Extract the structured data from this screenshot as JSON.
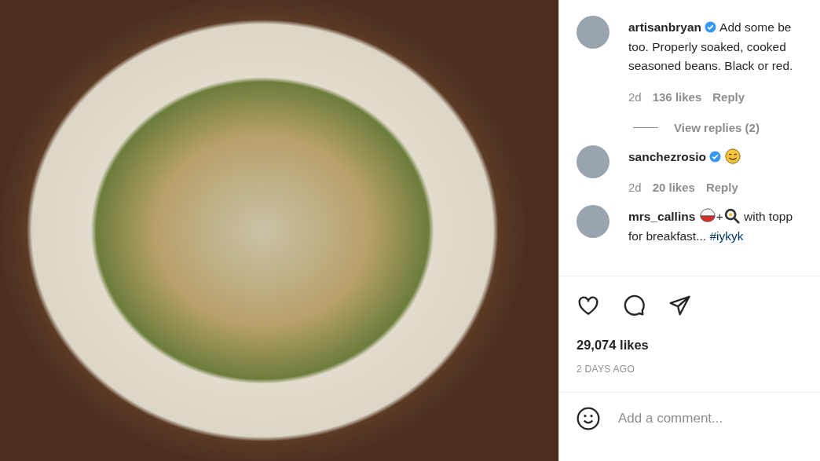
{
  "comments": [
    {
      "username": "artisanbryan",
      "verified": true,
      "segments": [
        {
          "kind": "text",
          "text": "Add some be\ntoo. Properly soaked, cooked\nseasoned beans. Black or red."
        }
      ],
      "time": "2d",
      "likes": "136 likes",
      "reply": "Reply",
      "view_replies": "View replies (2)"
    },
    {
      "username": "sanchezrosio",
      "verified": true,
      "segments": [
        {
          "kind": "drool-emoji"
        }
      ],
      "time": "2d",
      "likes": "20 likes",
      "reply": "Reply"
    },
    {
      "username": "mrs_callins",
      "verified": false,
      "segments": [
        {
          "kind": "bowl-emoji"
        },
        {
          "kind": "text",
          "text": "+"
        },
        {
          "kind": "pan-emoji"
        },
        {
          "kind": "text",
          "text": " with topp\nfor breakfast... "
        },
        {
          "kind": "hashtag",
          "text": "#iykyk"
        }
      ]
    }
  ],
  "likes": "29,074 likes",
  "posted": "2 DAYS AGO",
  "comment_box": {
    "placeholder": "Add a comment..."
  }
}
